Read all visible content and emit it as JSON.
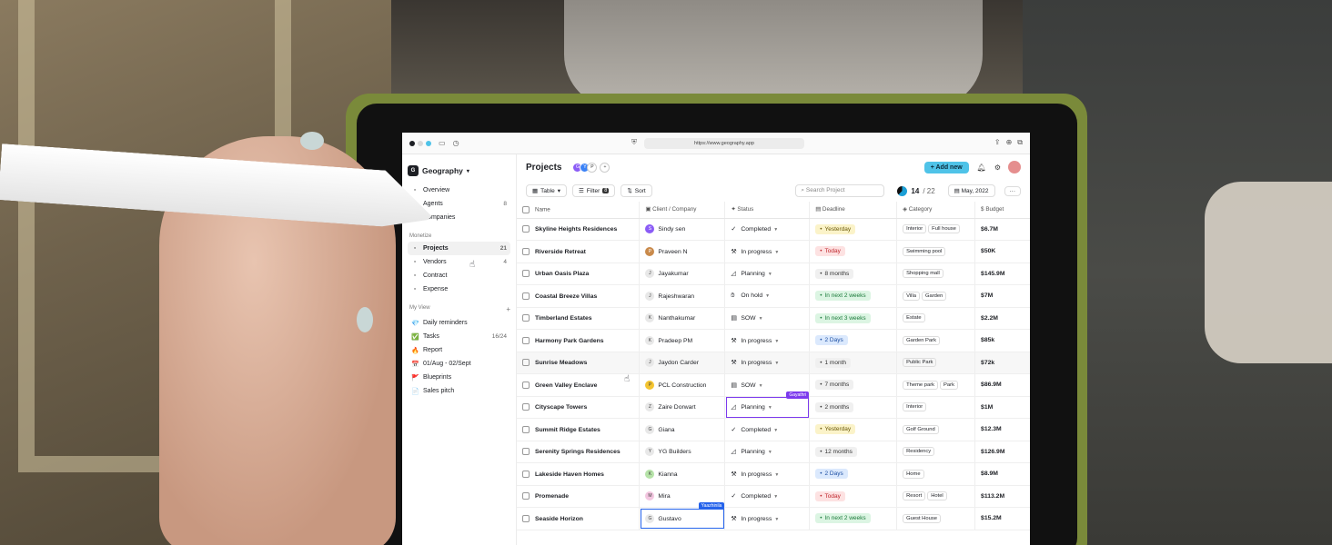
{
  "browser": {
    "url": "https://www.geography.app",
    "dot_colors": [
      "#1d1f24",
      "#d9d9d9",
      "#4fc3e8"
    ]
  },
  "sidebar": {
    "workspace": "Geography",
    "top_items": [
      {
        "label": "Overview",
        "icon": "home-icon",
        "count": ""
      },
      {
        "label": "Agents",
        "icon": "users-icon",
        "count": "8"
      },
      {
        "label": "Companies",
        "icon": "building-icon",
        "count": ""
      }
    ],
    "section1_label": "Monetize",
    "monetize_items": [
      {
        "label": "Projects",
        "icon": "projects-icon",
        "count": "21",
        "active": true
      },
      {
        "label": "Vendors",
        "icon": "vendors-icon",
        "count": "4"
      },
      {
        "label": "Contract",
        "icon": "contract-icon",
        "count": ""
      },
      {
        "label": "Expense",
        "icon": "dollar-icon",
        "count": ""
      }
    ],
    "section2_label": "My View",
    "myview_items": [
      {
        "label": "Daily reminders",
        "icon": "diamond-icon",
        "emoji": "💎",
        "count": ""
      },
      {
        "label": "Tasks",
        "icon": "check-icon",
        "emoji": "✅",
        "count": "16/24"
      },
      {
        "label": "Report",
        "icon": "fire-icon",
        "emoji": "🔥",
        "count": ""
      },
      {
        "label": "01/Aug - 02/Sept",
        "icon": "calendar-icon",
        "emoji": "📅",
        "count": ""
      },
      {
        "label": "Blueprints",
        "icon": "flag-icon",
        "emoji": "🚩",
        "count": ""
      },
      {
        "label": "Sales pitch",
        "icon": "document-icon",
        "emoji": "📄",
        "count": ""
      }
    ]
  },
  "header": {
    "title": "Projects",
    "avatars": [
      "G",
      "Y",
      "P",
      "+"
    ],
    "add_label": "+ Add new"
  },
  "toolbar": {
    "view_label": "Table",
    "filter_label": "Filter",
    "filter_count": "8",
    "sort_label": "Sort",
    "search_placeholder": "Search Project",
    "progress_done": "14",
    "progress_total": "/ 22",
    "progress_fraction": 0.636,
    "date_label": "May, 2022"
  },
  "table": {
    "columns": [
      "Name",
      "Client / Company",
      "Status",
      "Deadline",
      "Category",
      "Budget"
    ],
    "rows": [
      {
        "name": "Skyline Heights Residences",
        "client": "Sindy sen",
        "client_initial": "S",
        "status": "Completed",
        "deadline": "Yesterday",
        "deadline_tone": "yellow",
        "categories": [
          "Interior",
          "Full house"
        ],
        "budget": "$6.7M"
      },
      {
        "name": "Riverside Retreat",
        "client": "Praveen N",
        "client_initial": "P",
        "status": "In progress",
        "deadline": "Today",
        "deadline_tone": "red",
        "categories": [
          "Swimming pool"
        ],
        "budget": "$50K"
      },
      {
        "name": "Urban Oasis Plaza",
        "client": "Jayakumar",
        "client_initial": "J",
        "status": "Planning",
        "deadline": "8 months",
        "deadline_tone": "gray",
        "categories": [
          "Shopping mall"
        ],
        "budget": "$145.9M"
      },
      {
        "name": "Coastal Breeze Villas",
        "client": "Rajeshwaran",
        "client_initial": "J",
        "status": "On hold",
        "deadline": "In next 2 weeks",
        "deadline_tone": "green",
        "categories": [
          "Villa",
          "Garden"
        ],
        "budget": "$7M"
      },
      {
        "name": "Timberland Estates",
        "client": "Nanthakumar",
        "client_initial": "K",
        "status": "SOW",
        "deadline": "In next 3 weeks",
        "deadline_tone": "green",
        "categories": [
          "Estate"
        ],
        "budget": "$2.2M"
      },
      {
        "name": "Harmony Park Gardens",
        "client": "Pradeep PM",
        "client_initial": "K",
        "status": "In progress",
        "deadline": "2 Days",
        "deadline_tone": "blue",
        "categories": [
          "Garden Park"
        ],
        "budget": "$85k"
      },
      {
        "name": "Sunrise Meadows",
        "client": "Jaydon Carder",
        "client_initial": "J",
        "status": "In progress",
        "deadline": "1 month",
        "deadline_tone": "gray",
        "categories": [
          "Public Park"
        ],
        "budget": "$72k"
      },
      {
        "name": "Green Valley Enclave",
        "client": "PCL Construction",
        "client_initial": "P",
        "status": "SOW",
        "deadline": "7 months",
        "deadline_tone": "gray",
        "categories": [
          "Theme park",
          "Park"
        ],
        "budget": "$86.9M"
      },
      {
        "name": "Cityscape Towers",
        "client": "Zaire Dorwart",
        "client_initial": "Z",
        "status": "Planning",
        "deadline": "2 months",
        "deadline_tone": "gray",
        "categories": [
          "Interior"
        ],
        "budget": "$1M"
      },
      {
        "name": "Summit Ridge Estates",
        "client": "Giana",
        "client_initial": "G",
        "status": "Completed",
        "deadline": "Yesterday",
        "deadline_tone": "yellow",
        "categories": [
          "Golf Ground"
        ],
        "budget": "$12.3M"
      },
      {
        "name": "Serenity Springs Residences",
        "client": "YG Builders",
        "client_initial": "Y",
        "status": "Planning",
        "deadline": "12 months",
        "deadline_tone": "gray",
        "categories": [
          "Residency"
        ],
        "budget": "$126.9M"
      },
      {
        "name": "Lakeside Haven Homes",
        "client": "Kianna",
        "client_initial": "K",
        "status": "In progress",
        "deadline": "2 Days",
        "deadline_tone": "blue",
        "categories": [
          "Home"
        ],
        "budget": "$8.9M"
      },
      {
        "name": "Promenade",
        "client": "Mira",
        "client_initial": "M",
        "status": "Completed",
        "deadline": "Today",
        "deadline_tone": "red",
        "categories": [
          "Resort",
          "Hotel"
        ],
        "budget": "$113.2M"
      },
      {
        "name": "Seaside Horizon",
        "client": "Gustavo",
        "client_initial": "G",
        "status": "In progress",
        "deadline": "In next 2 weeks",
        "deadline_tone": "green",
        "categories": [
          "Guest House"
        ],
        "budget": "$15.2M"
      }
    ]
  },
  "collaborators": {
    "status_editor": "Gayathri",
    "client_editor": "Yaazhinila",
    "status_color": "#7c3aed",
    "client_color": "#2563eb"
  },
  "tones": {
    "yellow": {
      "bg": "#fbf3c9",
      "fg": "#6b5a08"
    },
    "red": {
      "bg": "#fde2e2",
      "fg": "#c0262d"
    },
    "gray": {
      "bg": "#f0f0f0",
      "fg": "#333333"
    },
    "green": {
      "bg": "#dcf5e3",
      "fg": "#1b7a3a"
    },
    "blue": {
      "bg": "#dbe9fd",
      "fg": "#1d4fa3"
    }
  }
}
